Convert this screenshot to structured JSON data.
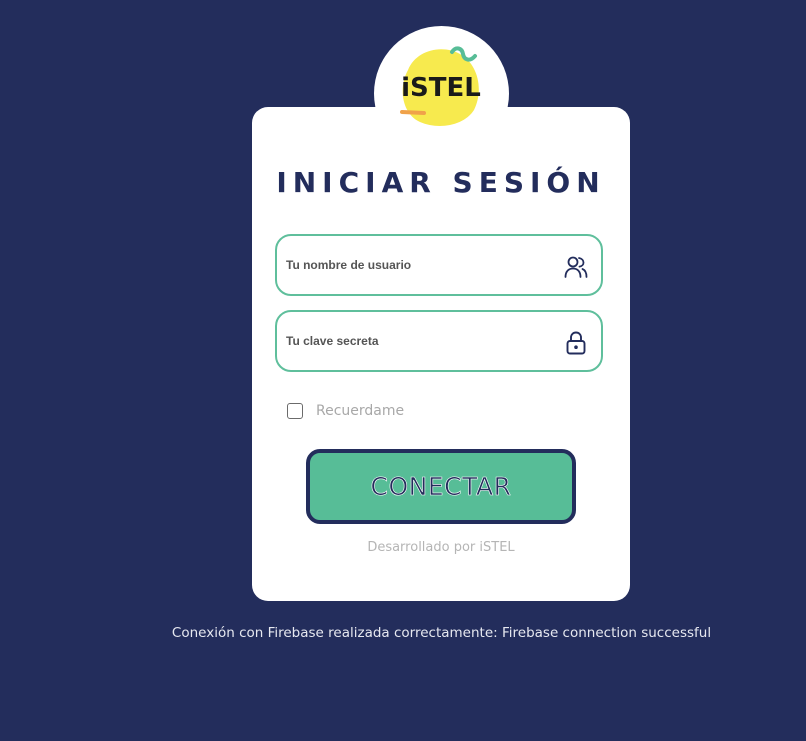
{
  "logo": {
    "text": "iSTEL",
    "icon": "istel-logo"
  },
  "login": {
    "title": "INICIAR SESIÓN",
    "username_placeholder": "Tu nombre de usuario",
    "username_icon": "users-icon",
    "password_placeholder": "Tu clave secreta",
    "password_icon": "lock-icon",
    "remember_label": "Recuerdame",
    "remember_checked": false,
    "submit_label": "CONECTAR",
    "footer": "Desarrollado por iSTEL"
  },
  "status_message": "Conexión con Firebase realizada correctamente: Firebase connection successful",
  "colors": {
    "background": "#232d5c",
    "accent": "#57bd97",
    "card": "#ffffff",
    "logo_yellow": "#f7ea4e"
  }
}
